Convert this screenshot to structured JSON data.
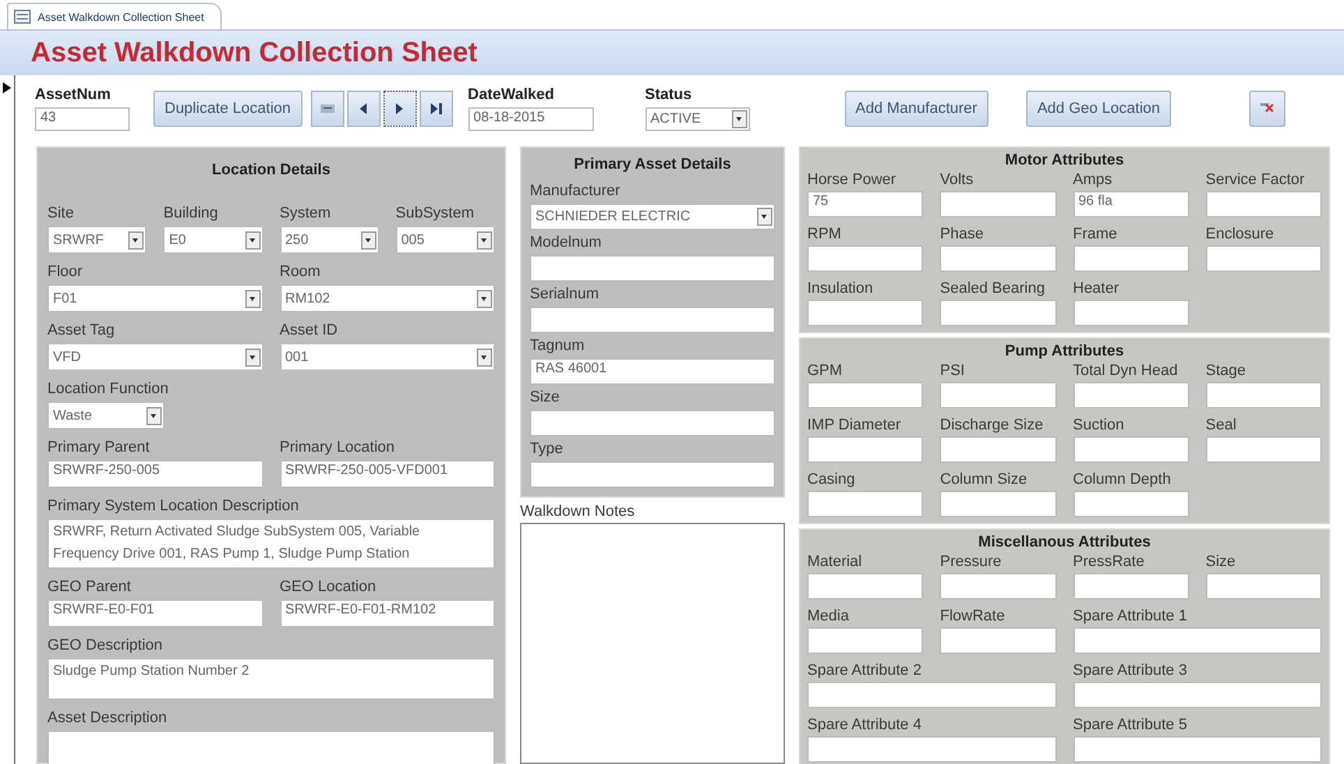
{
  "tab": {
    "label": "Asset Walkdown Collection Sheet"
  },
  "title": "Asset Walkdown Collection Sheet",
  "toolbar": {
    "asset_num": {
      "label": "AssetNum",
      "value": "43"
    },
    "duplicate_button": "Duplicate Location",
    "date_walked": {
      "label": "DateWalked",
      "value": "08-18-2015"
    },
    "status": {
      "label": "Status",
      "value": "ACTIVE"
    },
    "add_manufacturer_button": "Add Manufacturer",
    "add_geo_location_button": "Add Geo Location"
  },
  "location_details": {
    "title": "Location Details",
    "rows": [
      [
        {
          "label": "Site",
          "value": "SRWRF",
          "kind": "combo"
        },
        {
          "label": "Building",
          "value": "E0",
          "kind": "combo"
        },
        {
          "label": "System",
          "value": "250",
          "kind": "combo"
        },
        {
          "label": "SubSystem",
          "value": "005",
          "kind": "combo"
        }
      ],
      [
        {
          "label": "Floor",
          "value": "F01",
          "kind": "combo"
        },
        {
          "label": "Room",
          "value": "RM102",
          "kind": "combo"
        }
      ],
      [
        {
          "label": "Asset Tag",
          "value": "VFD",
          "kind": "combo"
        },
        {
          "label": "Asset ID",
          "value": "001",
          "kind": "combo"
        }
      ],
      [
        {
          "label": "Location Function",
          "value": "Waste",
          "kind": "combo"
        }
      ],
      [
        {
          "label": "Primary Parent",
          "value": "SRWRF-250-005",
          "kind": "text"
        },
        {
          "label": "Primary Location",
          "value": "SRWRF-250-005-VFD001",
          "kind": "text"
        }
      ],
      [
        {
          "label": "Primary System Location Description",
          "value": "SRWRF, Return Activated Sludge SubSystem 005, Variable Frequency Drive 001, RAS Pump 1, Sludge Pump Station",
          "kind": "memo"
        }
      ],
      [
        {
          "label": "GEO Parent",
          "value": "SRWRF-E0-F01",
          "kind": "text"
        },
        {
          "label": "GEO Location",
          "value": "SRWRF-E0-F01-RM102",
          "kind": "text"
        }
      ],
      [
        {
          "label": "GEO Description",
          "value": "Sludge Pump Station Number 2",
          "kind": "memo"
        }
      ],
      [
        {
          "label": "Asset Description",
          "kind": "memo"
        }
      ]
    ]
  },
  "primary_asset_details": {
    "title": "Primary Asset Details",
    "fields": [
      {
        "label": "Manufacturer",
        "value": "SCHNIEDER ELECTRIC",
        "kind": "combo"
      },
      {
        "label": "Modelnum",
        "kind": "text"
      },
      {
        "label": "Serialnum",
        "kind": "text"
      },
      {
        "label": "Tagnum",
        "value": "RAS 46001",
        "kind": "text"
      },
      {
        "label": "Size",
        "kind": "text"
      },
      {
        "label": "Type",
        "kind": "text"
      }
    ]
  },
  "walkdown_notes": {
    "label": "Walkdown Notes"
  },
  "attribute_panels": [
    {
      "title": "Motor Attributes",
      "fields": [
        {
          "label": "Horse Power",
          "value": "75",
          "kind": "text"
        },
        {
          "label": "Volts",
          "kind": "text"
        },
        {
          "label": "Amps",
          "value": "96 fla",
          "kind": "text"
        },
        {
          "label": "Service Factor",
          "kind": "text"
        },
        {
          "label": "RPM",
          "kind": "text"
        },
        {
          "label": "Phase",
          "kind": "text"
        },
        {
          "label": "Frame",
          "kind": "text"
        },
        {
          "label": "Enclosure",
          "kind": "text"
        },
        {
          "label": "Insulation",
          "kind": "text"
        },
        {
          "label": "Sealed Bearing",
          "kind": "text"
        },
        {
          "label": "Heater",
          "kind": "text"
        }
      ]
    },
    {
      "title": "Pump Attributes",
      "fields": [
        {
          "label": "GPM",
          "kind": "text"
        },
        {
          "label": "PSI",
          "kind": "text"
        },
        {
          "label": "Total Dyn Head",
          "kind": "text"
        },
        {
          "label": "Stage",
          "kind": "text"
        },
        {
          "label": "IMP Diameter",
          "kind": "text"
        },
        {
          "label": "Discharge Size",
          "kind": "text"
        },
        {
          "label": "Suction",
          "kind": "text"
        },
        {
          "label": "Seal",
          "kind": "text"
        },
        {
          "label": "Casing",
          "kind": "text"
        },
        {
          "label": "Column Size",
          "kind": "text"
        },
        {
          "label": "Column Depth",
          "kind": "text"
        }
      ]
    },
    {
      "title": "Miscellanous Attributes",
      "fields": [
        {
          "label": "Material",
          "kind": "text"
        },
        {
          "label": "Pressure",
          "kind": "text"
        },
        {
          "label": "PressRate",
          "kind": "text"
        },
        {
          "label": "Size",
          "kind": "text"
        },
        {
          "label": "Media",
          "kind": "text"
        },
        {
          "label": "FlowRate",
          "kind": "text"
        },
        {
          "label": "Spare Attribute 1",
          "kind": "wide"
        },
        {
          "label": "Spare Attribute 2",
          "kind": "wide"
        },
        {
          "label": "Spare Attribute 3",
          "kind": "wide"
        },
        {
          "label": "Spare Attribute 4",
          "kind": "wide"
        },
        {
          "label": "Spare Attribute 5",
          "kind": "wide"
        }
      ]
    }
  ]
}
